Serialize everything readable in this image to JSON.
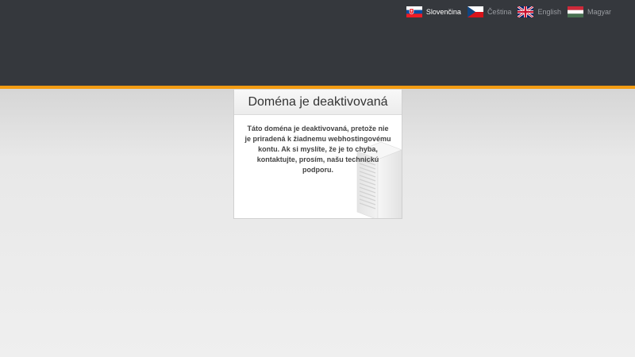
{
  "languages": {
    "items": [
      {
        "label": "Slovenčina",
        "active": true
      },
      {
        "label": "Čeština",
        "active": false
      },
      {
        "label": "English",
        "active": false
      },
      {
        "label": "Magyar",
        "active": false
      }
    ]
  },
  "notice": {
    "title": "Doména je deaktivovaná",
    "message": "Táto doména je deaktivovaná, pretože nie je priradená k žiadnemu webhostingovému kontu. Ak si myslíte, že je to chyba, kontaktujte, prosím, našu technickú podporu."
  },
  "colors": {
    "header_bg": "#35383d",
    "accent": "#f39c12"
  },
  "icons": {
    "server": "server-rack-icon"
  }
}
